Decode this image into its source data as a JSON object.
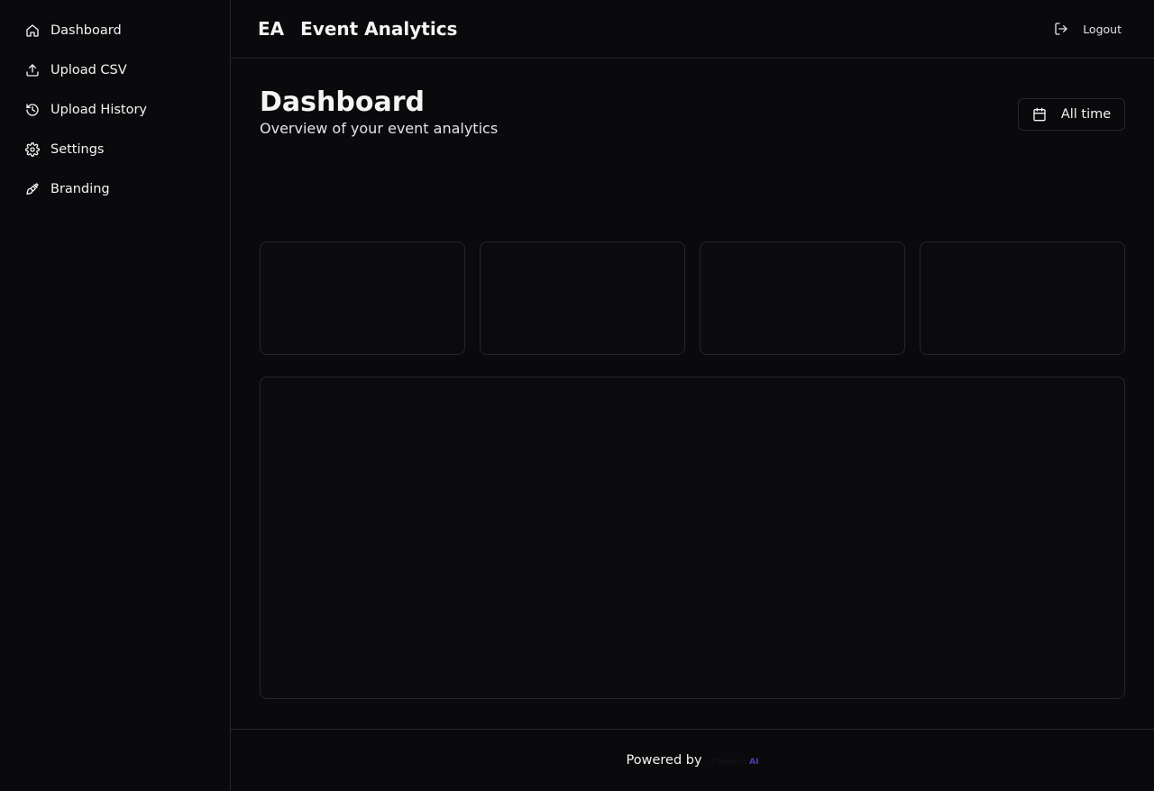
{
  "sidebar": {
    "items": [
      {
        "label": "Dashboard",
        "icon": "home-icon"
      },
      {
        "label": "Upload CSV",
        "icon": "upload-icon"
      },
      {
        "label": "Upload History",
        "icon": "history-icon"
      },
      {
        "label": "Settings",
        "icon": "gear-icon"
      },
      {
        "label": "Branding",
        "icon": "brush-icon"
      }
    ]
  },
  "header": {
    "brand_mark": "EA",
    "app_title": "Event Analytics",
    "logout_label": "Logout"
  },
  "page": {
    "title": "Dashboard",
    "subtitle": "Overview of your event analytics",
    "range_label": "All time"
  },
  "footer": {
    "powered_by": "Powered by",
    "logo_text": "Phoenix",
    "logo_suffix": "AI"
  },
  "colors": {
    "background": "#0a0a0c",
    "border": "#27272a",
    "text": "#f4f4f5",
    "accent": "#4c3fb5"
  }
}
